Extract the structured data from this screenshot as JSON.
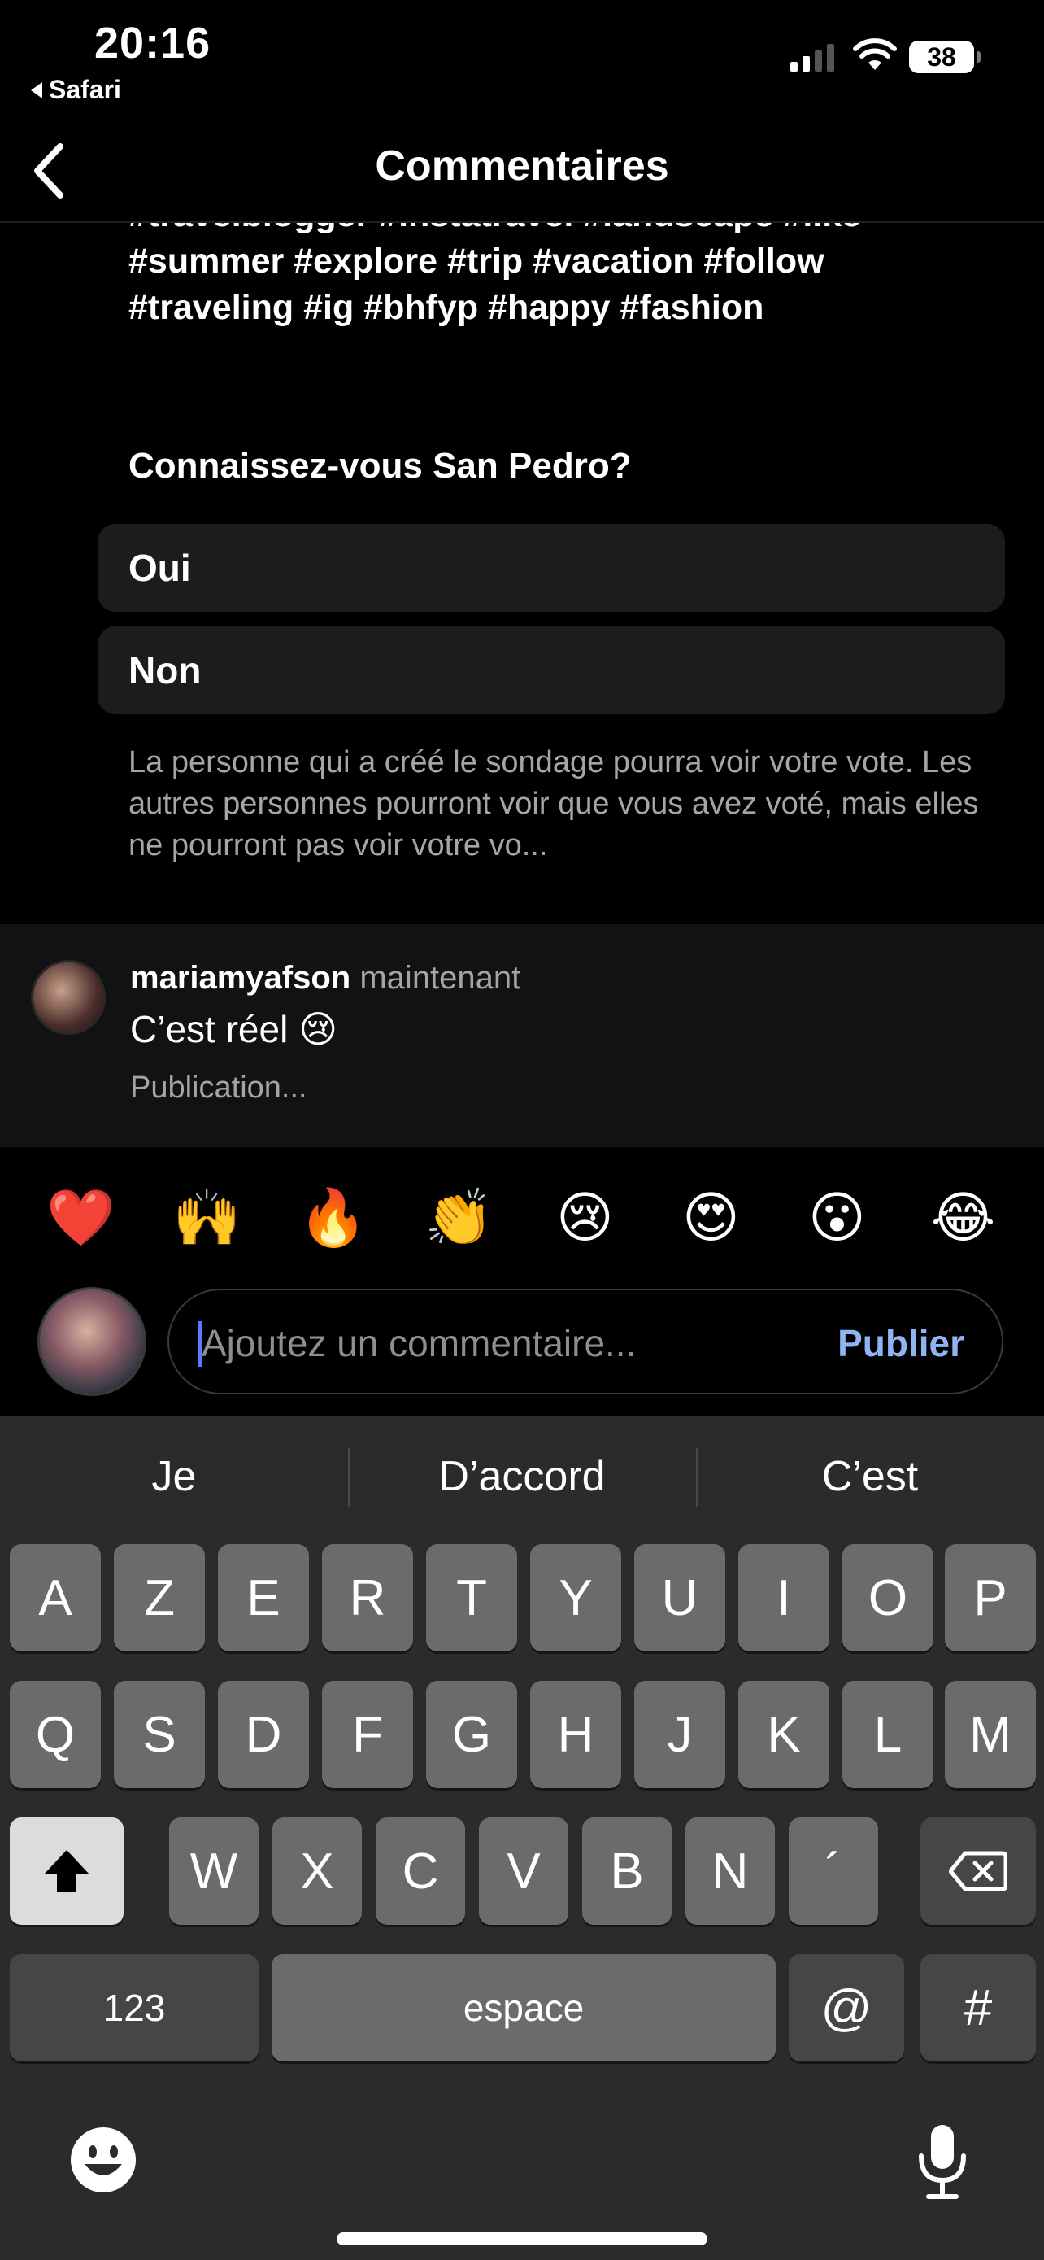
{
  "status_bar": {
    "time": "20:16",
    "back_app": "Safari",
    "battery": "38"
  },
  "header": {
    "title": "Commentaires"
  },
  "post": {
    "hashtag_lines": [
      "#travelblogger #instatravel #landscape #like",
      "#summer #explore #trip #vacation #follow",
      "#traveling #ig #bhfyp #happy #fashion"
    ],
    "poll": {
      "question": "Connaissez-vous San Pedro?",
      "options": [
        "Oui",
        "Non"
      ],
      "note": "La personne qui a créé le sondage pourra voir votre vote. Les autres personnes pourront voir que vous avez voté, mais elles ne pourront pas voir votre vo..."
    }
  },
  "comment": {
    "username": "mariamyafson",
    "time": "maintenant",
    "text": "C’est réel 😢",
    "status": "Publication..."
  },
  "reactions": [
    "❤️",
    "🙌",
    "🔥",
    "👏",
    "😢",
    "😍",
    "😮",
    "😂"
  ],
  "composer": {
    "placeholder": "Ajoutez un commentaire...",
    "publish_label": "Publier"
  },
  "keyboard": {
    "suggestions": [
      "Je",
      "D’accord",
      "C’est"
    ],
    "row1": [
      "A",
      "Z",
      "E",
      "R",
      "T",
      "Y",
      "U",
      "I",
      "O",
      "P"
    ],
    "row2": [
      "Q",
      "S",
      "D",
      "F",
      "G",
      "H",
      "J",
      "K",
      "L",
      "M"
    ],
    "row3": [
      "W",
      "X",
      "C",
      "V",
      "B",
      "N",
      "´"
    ],
    "numbers_label": "123",
    "space_label": "espace",
    "at_label": "@",
    "hash_label": "#"
  },
  "colors": {
    "accent_link": "#8fb4f2",
    "caret": "#5b7cff"
  }
}
